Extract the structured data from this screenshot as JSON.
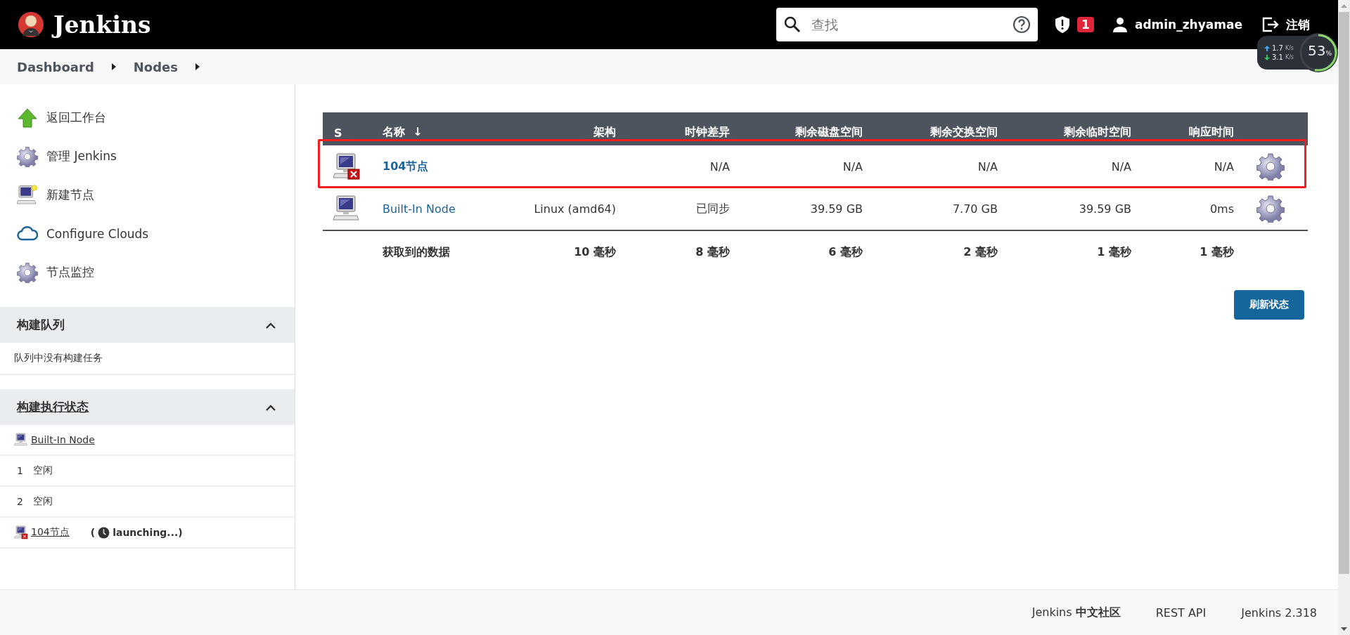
{
  "header": {
    "brand": "Jenkins",
    "search": {
      "placeholder": "查找"
    },
    "alerts": {
      "count": "1"
    },
    "user": "admin_zhyamae",
    "logout": "注销"
  },
  "net_monitor": {
    "up": "1.7",
    "up_unit": "K/s",
    "down": "3.1",
    "down_unit": "K/s",
    "load": "53",
    "load_unit": "%",
    "level": 0.53
  },
  "breadcrumbs": [
    {
      "label": "Dashboard"
    },
    {
      "label": "Nodes"
    }
  ],
  "sidebar": {
    "tasks": [
      {
        "kind": "arrow",
        "label": "返回工作台"
      },
      {
        "kind": "gear",
        "label": "管理 Jenkins"
      },
      {
        "kind": "new-computer",
        "label": "新建节点"
      },
      {
        "kind": "cloud",
        "label": "Configure Clouds"
      },
      {
        "kind": "gear",
        "label": "节点监控"
      }
    ],
    "queue": {
      "title": "构建队列",
      "expanded": true,
      "message": "队列中没有构建任务"
    },
    "executors": {
      "title": "构建执行状态",
      "expanded": true,
      "nodes": [
        {
          "name": "Built-In Node",
          "offline": false,
          "executors": [
            {
              "number": "1",
              "status": "空闲"
            },
            {
              "number": "2",
              "status": "空闲"
            }
          ]
        },
        {
          "name": "104节点",
          "offline": true,
          "status_prefix": "(",
          "status": "launching...)"
        }
      ]
    }
  },
  "table": {
    "columns": [
      {
        "label": "S"
      },
      {
        "label": "名称",
        "sort_indicator": "↓"
      },
      {
        "label": "架构"
      },
      {
        "label": "时钟差异"
      },
      {
        "label": "剩余磁盘空间"
      },
      {
        "label": "剩余交换空间"
      },
      {
        "label": "剩余临时空间"
      },
      {
        "label": "响应时间"
      }
    ],
    "rows": [
      {
        "name": "104节点",
        "offline": true,
        "highlighted": true,
        "clock": "N/A",
        "disk": "N/A",
        "swap": "N/A",
        "temp": "N/A",
        "response": "N/A"
      },
      {
        "name": "Built-In Node",
        "offline": false,
        "highlighted": false,
        "architecture": "Linux (amd64)",
        "clock": "已同步",
        "disk": "39.59 GB",
        "swap": "7.70 GB",
        "temp": "39.59 GB",
        "response": "0ms"
      }
    ],
    "summary": {
      "label": "获取到的数据",
      "timings": [
        "10 毫秒",
        "8 毫秒",
        "6 毫秒",
        "2 毫秒",
        "1 毫秒",
        "1 毫秒"
      ]
    }
  },
  "refresh_button": "刷新状态",
  "footer": {
    "links": [
      {
        "label": "Jenkins **中文社区**"
      },
      {
        "label": "REST API"
      },
      {
        "label": "Jenkins 2.318"
      }
    ]
  }
}
